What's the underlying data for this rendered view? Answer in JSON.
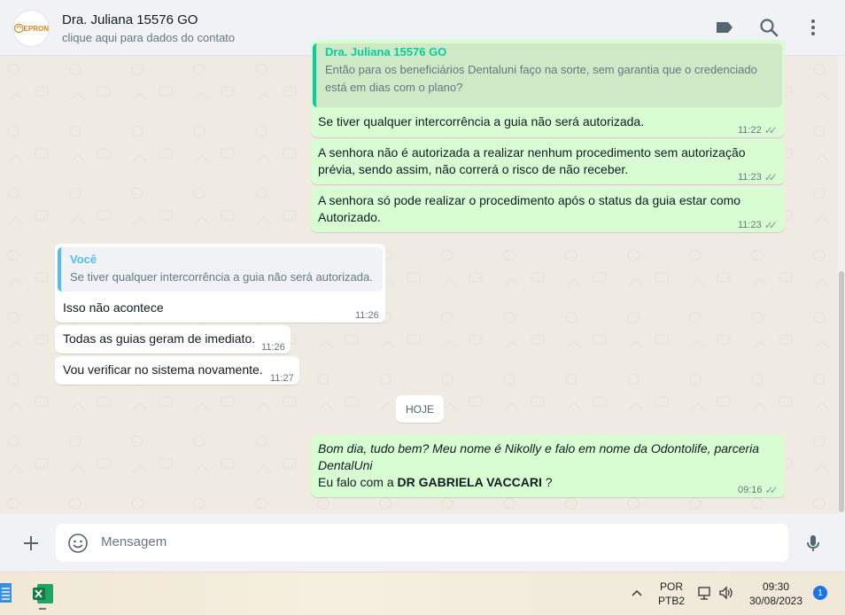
{
  "header": {
    "avatar_text": "EPRON",
    "contact_name": "Dra. Juliana 15576 GO",
    "contact_subtitle": "clique aqui para dados do contato",
    "icons": [
      "label-icon",
      "search-icon",
      "more-vertical-icon"
    ]
  },
  "messages": {
    "m1": {
      "quote_author": "Dra. Juliana 15576 GO",
      "quote_text": "Então para os beneficiários Dentaluni faço na sorte, sem garantia que o credenciado está em dias com o plano?",
      "text": "Se tiver qualquer intercorrência a guia não será autorizada.",
      "time": "11:22"
    },
    "m2": {
      "text": "A senhora não é autorizada a realizar nenhum procedimento sem autorização prévia, sendo assim, não correrá o risco de não receber.",
      "time": "11:23"
    },
    "m3": {
      "text": "A senhora só pode realizar o procedimento após o status da guia estar como Autorizado.",
      "time": "11:23"
    },
    "m4": {
      "quote_author": "Você",
      "quote_text": "Se tiver qualquer intercorrência a guia não será autorizada.",
      "text": "Isso não acontece",
      "time": "11:26"
    },
    "m5": {
      "text": "Todas as guias geram de imediato.",
      "time": "11:26"
    },
    "m6": {
      "text": "Vou verificar no sistema novamente.",
      "time": "11:27"
    },
    "date_chip": "HOJE",
    "m7": {
      "line1": "Bom dia, tudo bem? Meu nome é Nikolly e falo em nome da Odontolife, parceria DentalUni",
      "line2_prefix": "Eu falo com a ",
      "line2_bold": "DR GABRIELA VACCARI",
      "line2_suffix": " ?",
      "time": "09:16"
    }
  },
  "composer": {
    "placeholder": "Mensagem",
    "icons": [
      "plus-icon",
      "emoji-icon",
      "microphone-icon"
    ]
  },
  "taskbar": {
    "lang_top": "POR",
    "lang_bottom": "PTB2",
    "time": "09:30",
    "date": "30/08/2023",
    "notifications": "1"
  },
  "colors": {
    "outgoing": "#d9fdd3",
    "incoming": "#ffffff",
    "accent": "#06cf9c"
  }
}
